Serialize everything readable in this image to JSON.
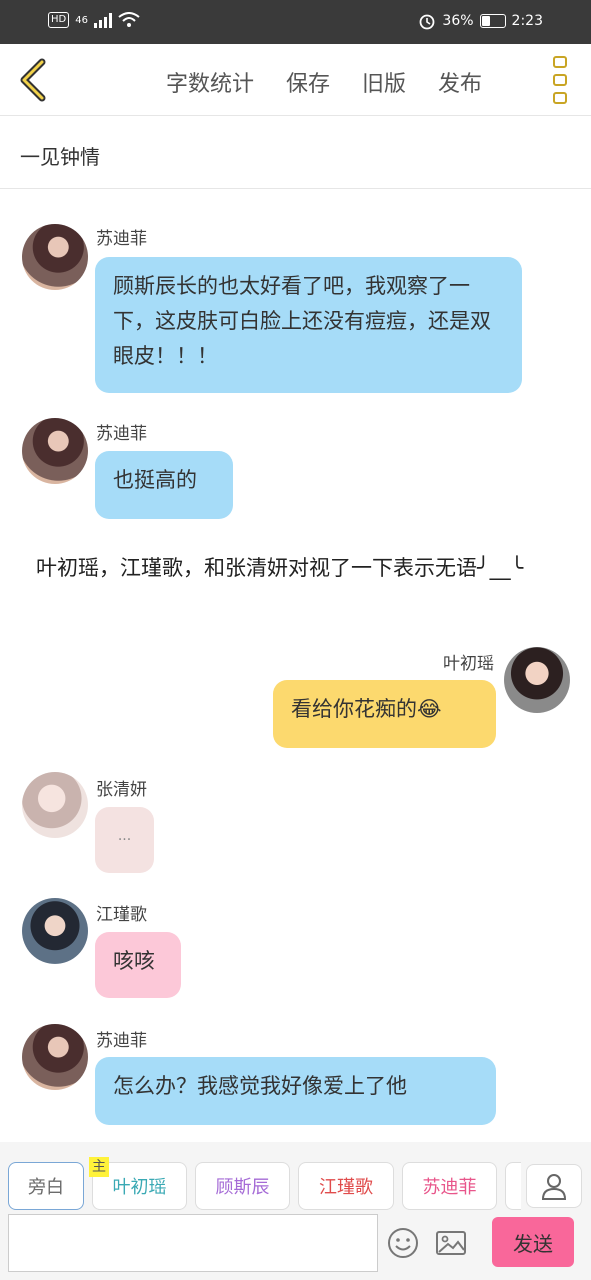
{
  "status_bar": {
    "hd": "HD",
    "network": "46",
    "battery": "36%",
    "time": "2:23"
  },
  "top_bar": {
    "actions": [
      "字数统计",
      "保存",
      "旧版",
      "发布"
    ]
  },
  "story_title": "一见钟情",
  "messages": [
    {
      "name": "苏迪菲",
      "text": "顾斯辰长的也太好看了吧，我观察了一下，这皮肤可白脸上还没有痘痘，还是双眼皮！！！"
    },
    {
      "name": "苏迪菲",
      "text": "也挺高的"
    },
    {
      "narration": "叶初瑶，江瑾歌，和张清妍对视了一下表示无语╯__╰"
    },
    {
      "name": "叶初瑶",
      "text": "看给你花痴的😂"
    },
    {
      "name": "张清妍",
      "text": "..."
    },
    {
      "name": "江瑾歌",
      "text": "咳咳"
    },
    {
      "name": "苏迪菲",
      "text": "怎么办？我感觉我好像爱上了他"
    }
  ],
  "bottom": {
    "roles": [
      "旁白",
      "叶初瑶",
      "顾斯辰",
      "江瑾歌",
      "苏迪菲"
    ],
    "main_badge": "主",
    "role_colors": [
      "#6b6b6b",
      "#3aa9b4",
      "#a56bd6",
      "#e04c4c",
      "#e8568b"
    ],
    "input_value": "",
    "send_label": "发送"
  }
}
